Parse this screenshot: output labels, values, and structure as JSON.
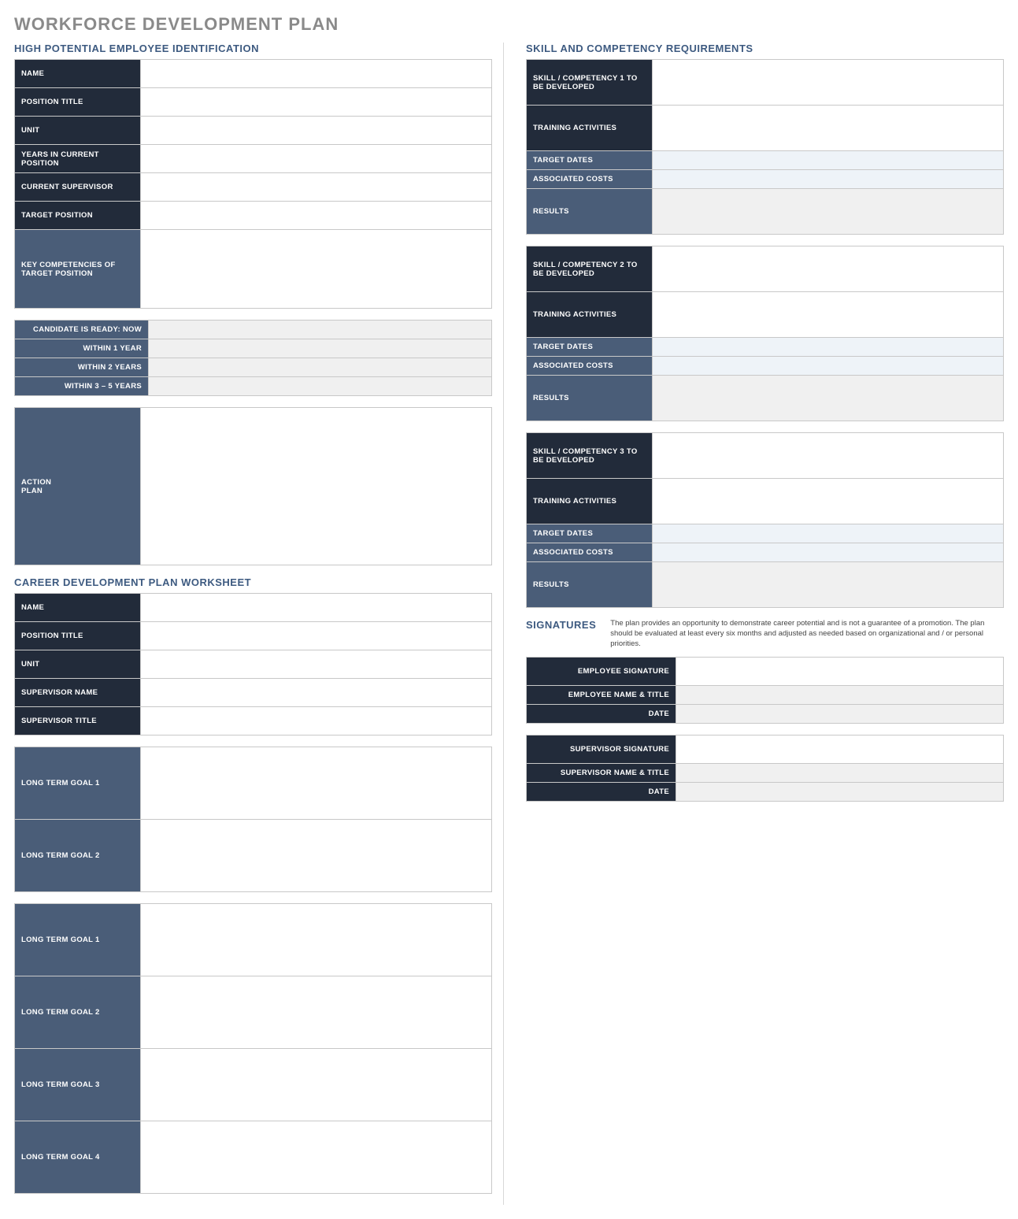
{
  "title": "WORKFORCE DEVELOPMENT PLAN",
  "sections": {
    "hipe": {
      "heading": "HIGH POTENTIAL EMPLOYEE IDENTIFICATION",
      "fields": {
        "name": "NAME",
        "position_title": "POSITION TITLE",
        "unit": "UNIT",
        "years_in_position": "YEARS IN CURRENT POSITION",
        "current_supervisor": "CURRENT SUPERVISOR",
        "target_position": "TARGET POSITION",
        "key_competencies": "KEY COMPETENCIES OF TARGET POSITION"
      },
      "readiness": {
        "now": "CANDIDATE IS READY:  NOW",
        "within1": "WITHIN 1 YEAR",
        "within2": "WITHIN 2 YEARS",
        "within35": "WITHIN 3 – 5 YEARS"
      },
      "action_plan": "ACTION\nPLAN"
    },
    "career": {
      "heading": "CAREER DEVELOPMENT PLAN WORKSHEET",
      "fields": {
        "name": "NAME",
        "position_title": "POSITION TITLE",
        "unit": "UNIT",
        "supervisor_name": "SUPERVISOR NAME",
        "supervisor_title": "SUPERVISOR TITLE"
      },
      "goals_a": {
        "g1": "LONG TERM GOAL 1",
        "g2": "LONG TERM GOAL 2"
      },
      "goals_b": {
        "g1": "LONG TERM GOAL 1",
        "g2": "LONG TERM GOAL 2",
        "g3": "LONG TERM GOAL 3",
        "g4": "LONG TERM GOAL 4"
      }
    },
    "skills": {
      "heading": "SKILL AND COMPETENCY REQUIREMENTS",
      "blocks": [
        {
          "skill": "SKILL / COMPETENCY 1 TO BE DEVELOPED",
          "training": "TRAINING ACTIVITIES",
          "dates": "TARGET DATES",
          "costs": "ASSOCIATED COSTS",
          "results": "RESULTS"
        },
        {
          "skill": "SKILL / COMPETENCY 2 TO BE DEVELOPED",
          "training": "TRAINING ACTIVITIES",
          "dates": "TARGET DATES",
          "costs": "ASSOCIATED COSTS",
          "results": "RESULTS"
        },
        {
          "skill": "SKILL / COMPETENCY 3 TO BE DEVELOPED",
          "training": "TRAINING ACTIVITIES",
          "dates": "TARGET DATES",
          "costs": "ASSOCIATED COSTS",
          "results": "RESULTS"
        }
      ]
    },
    "signatures": {
      "heading": "SIGNATURES",
      "note": "The plan provides an opportunity to demonstrate career potential and is not a guarantee of a promotion. The plan should be evaluated at least every six months and adjusted as needed based on organizational and / or personal priorities.",
      "employee": {
        "sig": "EMPLOYEE SIGNATURE",
        "name": "EMPLOYEE NAME & TITLE",
        "date": "DATE"
      },
      "supervisor": {
        "sig": "SUPERVISOR SIGNATURE",
        "name": "SUPERVISOR NAME & TITLE",
        "date": "DATE"
      }
    }
  }
}
